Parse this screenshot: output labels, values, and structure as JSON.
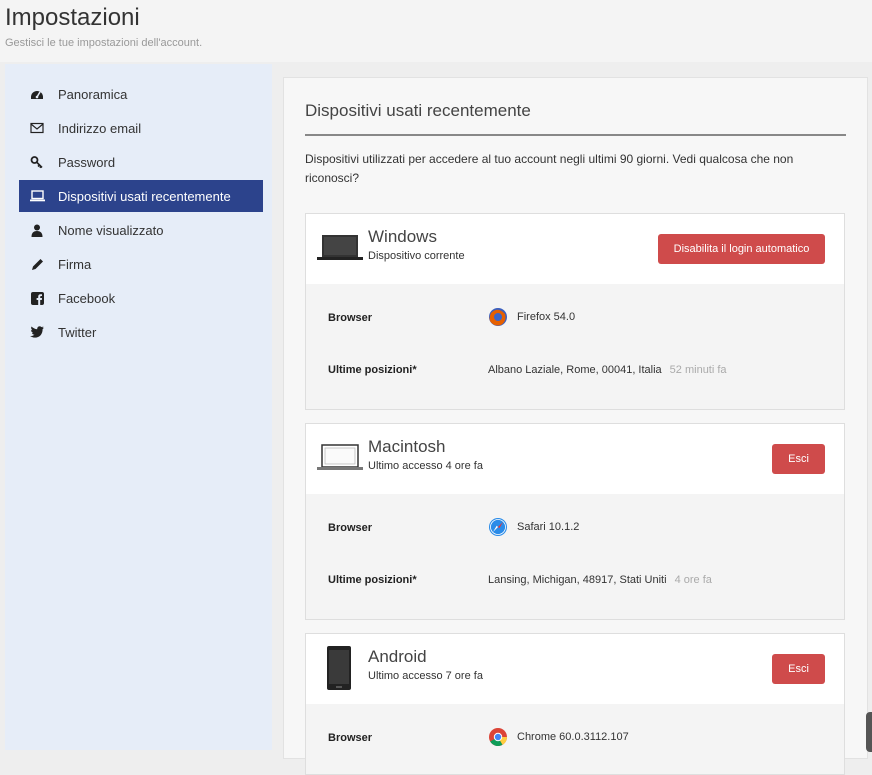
{
  "header": {
    "title": "Impostazioni",
    "subtitle": "Gestisci le tue impostazioni dell'account."
  },
  "sidebar": {
    "items": [
      {
        "label": "Panoramica",
        "icon": "dashboard-icon"
      },
      {
        "label": "Indirizzo email",
        "icon": "envelope-icon"
      },
      {
        "label": "Password",
        "icon": "key-icon"
      },
      {
        "label": "Dispositivi usati recentemente",
        "icon": "laptop-icon",
        "active": true
      },
      {
        "label": "Nome visualizzato",
        "icon": "user-icon"
      },
      {
        "label": "Firma",
        "icon": "pencil-icon"
      },
      {
        "label": "Facebook",
        "icon": "facebook-icon"
      },
      {
        "label": "Twitter",
        "icon": "twitter-icon"
      }
    ]
  },
  "main": {
    "heading": "Dispositivi usati recentemente",
    "intro": "Dispositivi utilizzati per accedere al tuo account negli ultimi 90 giorni.  Vedi qualcosa che non riconosci?"
  },
  "devices": [
    {
      "name": "Windows",
      "status": "Dispositivo corrente",
      "button": "Disabilita il login automatico",
      "browser_label": "Browser",
      "browser": "Firefox 54.0",
      "browser_icon": "firefox-icon",
      "location_label": "Ultime posizioni*",
      "location": "Albano Laziale, Rome, 00041, Italia",
      "location_time": "52 minuti fa"
    },
    {
      "name": "Macintosh",
      "status": "Ultimo accesso 4 ore fa",
      "button": "Esci",
      "browser_label": "Browser",
      "browser": "Safari 10.1.2",
      "browser_icon": "safari-icon",
      "location_label": "Ultime posizioni*",
      "location": "Lansing, Michigan, 48917, Stati Uniti",
      "location_time": "4 ore fa"
    },
    {
      "name": "Android",
      "status": "Ultimo accesso 7 ore fa",
      "button": "Esci",
      "browser_label": "Browser",
      "browser": "Chrome 60.0.3112.107",
      "browser_icon": "chrome-icon"
    }
  ],
  "colors": {
    "accent": "#2c438c",
    "danger": "#cf4b4b",
    "sidebar_bg": "#e6edf8"
  }
}
